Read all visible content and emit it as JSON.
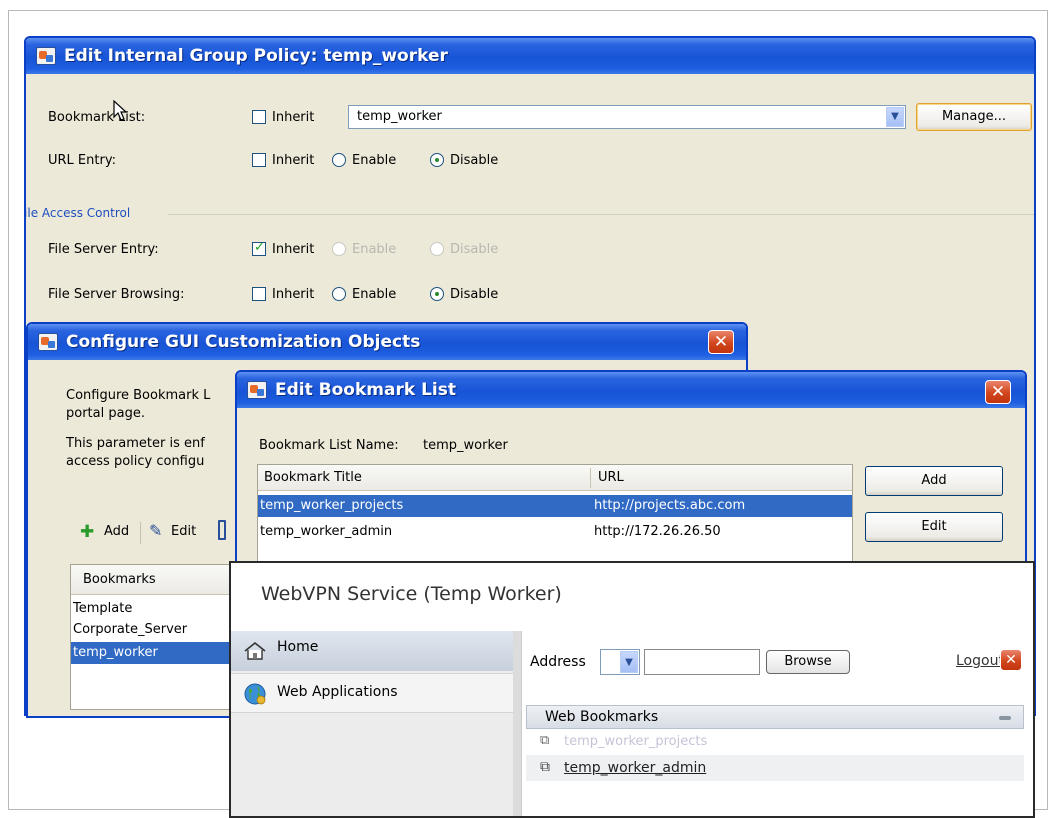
{
  "policy": {
    "title": "Edit Internal Group Policy: temp_worker",
    "bookmark_list_label": "Bookmark List:",
    "url_entry_label": "URL Entry:",
    "inherit_label": "Inherit",
    "bookmark_value": "temp_worker",
    "manage_label": "Manage...",
    "enable_label": "Enable",
    "disable_label": "Disable",
    "file_access_section": "File Access Control",
    "file_server_entry_label": "File Server Entry:",
    "file_server_browsing_label": "File Server Browsing:"
  },
  "gui": {
    "title": "Configure GUI Customization Objects",
    "desc1": "Configure Bookmark L",
    "desc2": "portal page.",
    "desc3": "This parameter is enf",
    "desc4": "access policy configu",
    "add_label": "Add",
    "edit_label": "Edit",
    "column_bookmarks": "Bookmarks",
    "items": [
      "Template",
      "Corporate_Server",
      "temp_worker"
    ]
  },
  "bookmark": {
    "title": "Edit Bookmark List",
    "list_name_label": "Bookmark List Name:",
    "list_name_value": "temp_worker",
    "col_title": "Bookmark Title",
    "col_url": "URL",
    "rows": [
      {
        "title": "temp_worker_projects",
        "url": "http://projects.abc.com"
      },
      {
        "title": "temp_worker_admin",
        "url": "http://172.26.26.50"
      }
    ],
    "add_label": "Add",
    "edit_label": "Edit"
  },
  "portal": {
    "title": "WebVPN Service (Temp Worker)",
    "nav_home": "Home",
    "nav_webapps": "Web Applications",
    "address_label": "Address",
    "browse_label": "Browse",
    "logout_label": "Logout",
    "web_bookmarks_label": "Web Bookmarks",
    "bookmarks": [
      "temp_worker_projects",
      "temp_worker_admin"
    ]
  }
}
